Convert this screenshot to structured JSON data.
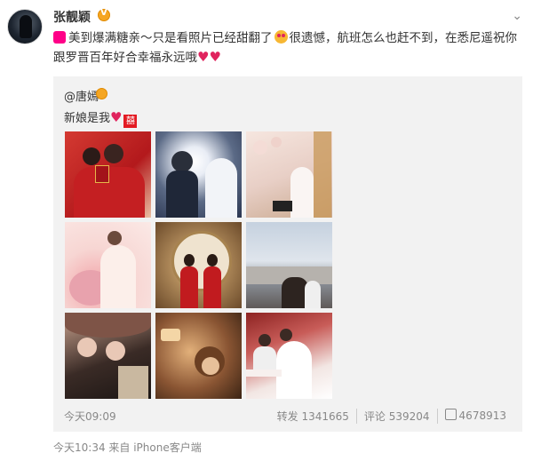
{
  "post": {
    "username": "张靓颖",
    "text_part1": "美到爆满糖亲～只是看照片已经甜翻了",
    "text_part2": "很遗憾，航班怎么也赶不到，在悉尼遥祝你跟罗晋百年好合幸福永远哦",
    "footer": "今天10:34 来自 iPhone客户端"
  },
  "repost": {
    "author": "@唐嫣",
    "text": "新娘是我",
    "xi_char": "囍",
    "time": "今天09:09",
    "repost_count": "转发 1341665",
    "comment_count": "评论 539204",
    "like_count": "4678913"
  },
  "icons": {
    "verified": "verified-badge-icon",
    "menu": "chevron-down-icon",
    "like": "thumbs-up-icon"
  }
}
